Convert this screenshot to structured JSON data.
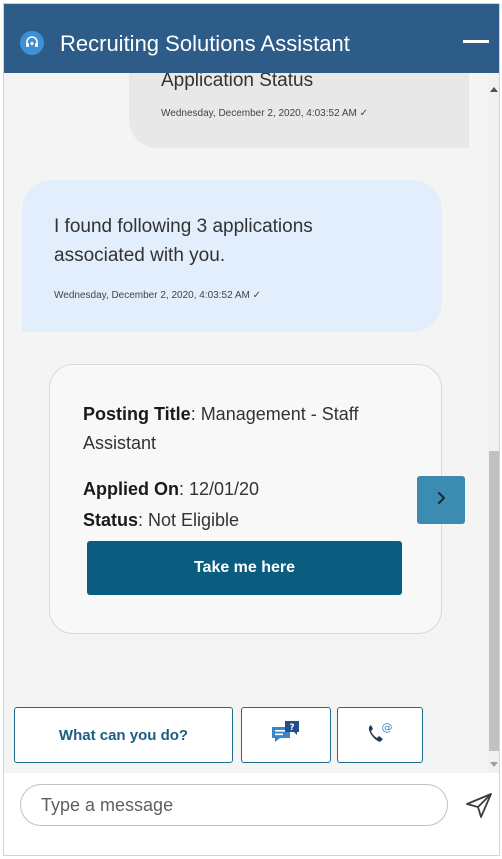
{
  "header": {
    "title": "Recruiting Solutions Assistant",
    "logo_icon": "assistant-headset-icon",
    "minimize_icon": "minimize-icon",
    "color": "#2d5c88"
  },
  "messages": {
    "user_prev": {
      "text": "Application Status",
      "timestamp": "Wednesday, December 2, 2020, 4:03:52 AM ✓"
    },
    "bot_reply": {
      "text": "I found following 3 applications associated with you.",
      "timestamp": "Wednesday, December 2, 2020, 4:03:52 AM ✓"
    }
  },
  "card": {
    "posting_label": "Posting Title",
    "posting_value": ": Management - Staff Assistant",
    "applied_label": "Applied On",
    "applied_value": ": 12/01/20",
    "status_label": "Status",
    "status_value": ": Not Eligible",
    "cta_label": "Take me here",
    "next_icon": "chevron-right-icon"
  },
  "quick_replies": {
    "what_label": "What can you do?",
    "faq_icon": "faq-chat-icon",
    "call_icon": "phone-at-icon"
  },
  "composer": {
    "placeholder": "Type a message",
    "value": "",
    "send_icon": "send-icon"
  },
  "colors": {
    "accent": "#0b5d7f",
    "bot_bubble": "#e2eefc",
    "user_bubble": "#e8e8e8"
  }
}
